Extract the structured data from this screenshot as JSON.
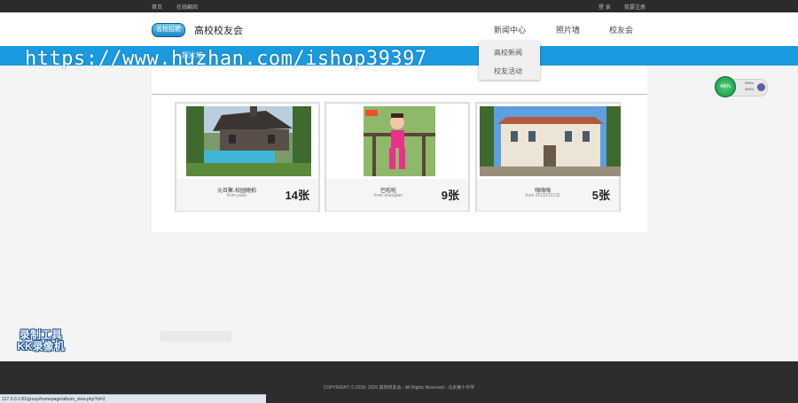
{
  "topbar": {
    "home": "首页",
    "sign_in_link": "在线翻阅",
    "login": "登 录",
    "register": "我要注册"
  },
  "header": {
    "logo_text": "名校招聘",
    "site_title": "高校校友会",
    "nav": [
      "新闻中心",
      "照片墙",
      "校友会"
    ]
  },
  "dropdown": {
    "items": [
      "高校新闻",
      "校友活动"
    ]
  },
  "breadcrumb": "照片墙",
  "watermark": "https://www.huzhan.com/ishop39397",
  "albums": [
    {
      "name": "元旦聚-校园随拍",
      "by": "from yuan",
      "count": "14张"
    },
    {
      "name": "巴啦啦",
      "by": "from zhangtan",
      "count": "9张"
    },
    {
      "name": "嗨嗨嗨",
      "by": "from 2019212132",
      "count": "5张"
    }
  ],
  "gauge": {
    "percent": "46%",
    "up": "30K/s",
    "down": "32K/s"
  },
  "kk_logo": {
    "line1": "录制工具",
    "line2": "KK录像机"
  },
  "footer": {
    "copyright": "COPYRIGHT © 2018- 2020 高校校友会 - All Rights Reserved - 北京第十中学"
  },
  "statusbar": {
    "url": "127.0.0.1:81/group/homepage/album_view.php?id=2"
  }
}
